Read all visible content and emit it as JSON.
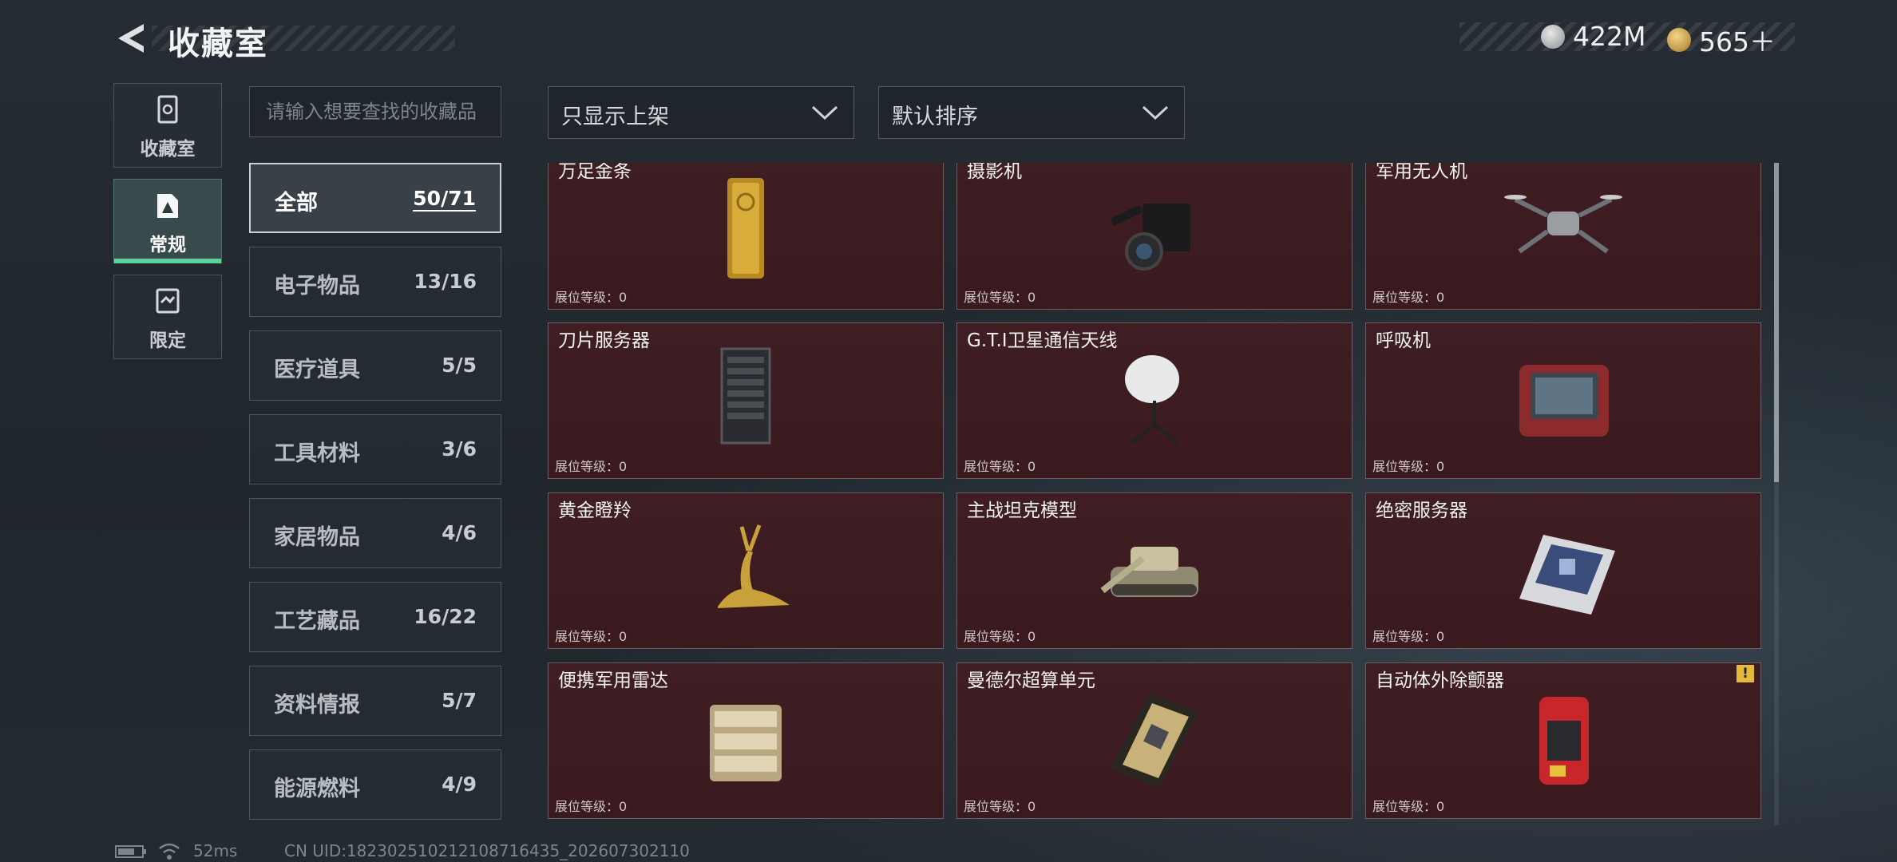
{
  "header": {
    "title": "收藏室"
  },
  "currency": {
    "silver": "422M",
    "gold": "565＋"
  },
  "left_nav": [
    {
      "label": "收藏室",
      "icon": "vault-icon",
      "active": false
    },
    {
      "label": "常规",
      "icon": "regular-collection-icon",
      "active": true
    },
    {
      "label": "限定",
      "icon": "limited-collection-icon",
      "active": false
    }
  ],
  "search": {
    "placeholder": "请输入想要查找的收藏品",
    "value": ""
  },
  "categories": [
    {
      "name": "全部",
      "count": "50/71",
      "active": true
    },
    {
      "name": "电子物品",
      "count": "13/16",
      "active": false
    },
    {
      "name": "医疗道具",
      "count": "5/5",
      "active": false
    },
    {
      "name": "工具材料",
      "count": "3/6",
      "active": false
    },
    {
      "name": "家居物品",
      "count": "4/6",
      "active": false
    },
    {
      "name": "工艺藏品",
      "count": "16/22",
      "active": false
    },
    {
      "name": "资料情报",
      "count": "5/7",
      "active": false
    },
    {
      "name": "能源燃料",
      "count": "4/9",
      "active": false
    }
  ],
  "filters": {
    "display_filter": "只显示上架",
    "sort": "默认排序"
  },
  "items": [
    {
      "name": "万足金条",
      "level": "展位等级：0",
      "icon": "gold-bar-icon"
    },
    {
      "name": "摄影机",
      "level": "展位等级：0",
      "icon": "camera-icon"
    },
    {
      "name": "军用无人机",
      "level": "展位等级：0",
      "icon": "drone-icon"
    },
    {
      "name": "刀片服务器",
      "level": "展位等级：0",
      "icon": "blade-server-icon"
    },
    {
      "name": "G.T.I卫星通信天线",
      "level": "展位等级：0",
      "icon": "satellite-antenna-icon"
    },
    {
      "name": "呼吸机",
      "level": "展位等级：0",
      "icon": "ventilator-icon"
    },
    {
      "name": "黄金瞪羚",
      "level": "展位等级：0",
      "icon": "golden-gazelle-icon"
    },
    {
      "name": "主战坦克模型",
      "level": "展位等级：0",
      "icon": "tank-model-icon"
    },
    {
      "name": "绝密服务器",
      "level": "展位等级：0",
      "icon": "secret-server-icon"
    },
    {
      "name": "便携军用雷达",
      "level": "展位等级：0",
      "icon": "portable-radar-icon"
    },
    {
      "name": "曼德尔超算单元",
      "level": "展位等级：0",
      "icon": "supercomputer-unit-icon"
    },
    {
      "name": "自动体外除颤器",
      "level": "展位等级：0",
      "icon": "defibrillator-icon",
      "warning": "!"
    }
  ],
  "footer": {
    "ping": "52ms",
    "uid": "CN UID:18230251021210871643​5_202607302110"
  }
}
